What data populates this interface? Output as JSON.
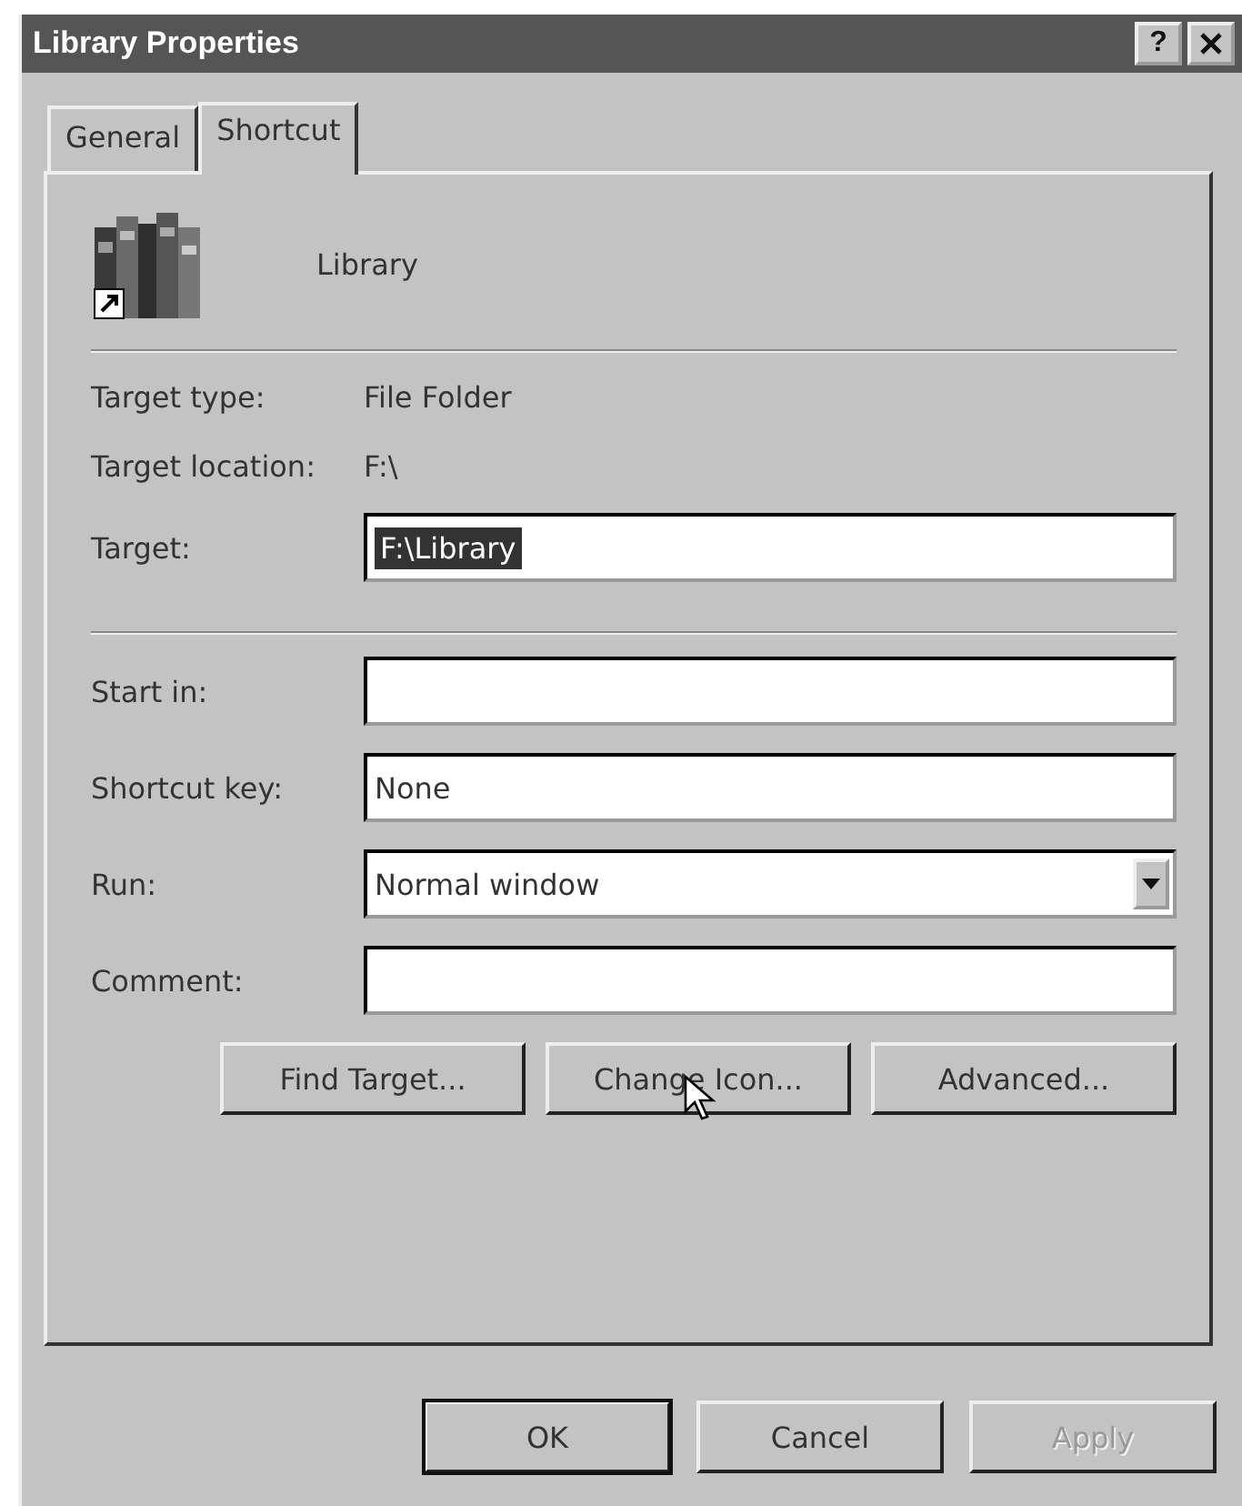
{
  "window": {
    "title": "Library Properties",
    "controls": [
      {
        "kind": "help",
        "label": "?"
      },
      {
        "kind": "close"
      }
    ]
  },
  "tabs": [
    {
      "label": "General",
      "selected": false
    },
    {
      "label": "Shortcut",
      "selected": true
    }
  ],
  "header": {
    "name": "Library"
  },
  "info": [
    {
      "label": "Target type:",
      "value": "File Folder"
    },
    {
      "label": "Target location:",
      "value": "F:\\"
    }
  ],
  "target": {
    "label": "Target:",
    "value": "F:\\Library",
    "selected": true
  },
  "fields": [
    {
      "kind": "text",
      "label": "Start in:"
    },
    {
      "kind": "text",
      "label": "Shortcut key:",
      "value": "None"
    },
    {
      "kind": "dropdown",
      "label": "Run:",
      "value": "Normal window"
    },
    {
      "kind": "text",
      "label": "Comment:"
    }
  ],
  "action_buttons": [
    {
      "label": "Find Target...",
      "disabled": false
    },
    {
      "label": "Change Icon...",
      "disabled": false,
      "hovered": true
    },
    {
      "label": "Advanced...",
      "disabled": false
    }
  ],
  "dialog_buttons": [
    {
      "label": "OK",
      "default": true,
      "disabled": false
    },
    {
      "label": "Cancel",
      "default": false,
      "disabled": false
    },
    {
      "label": "Apply",
      "default": false,
      "disabled": true
    }
  ]
}
